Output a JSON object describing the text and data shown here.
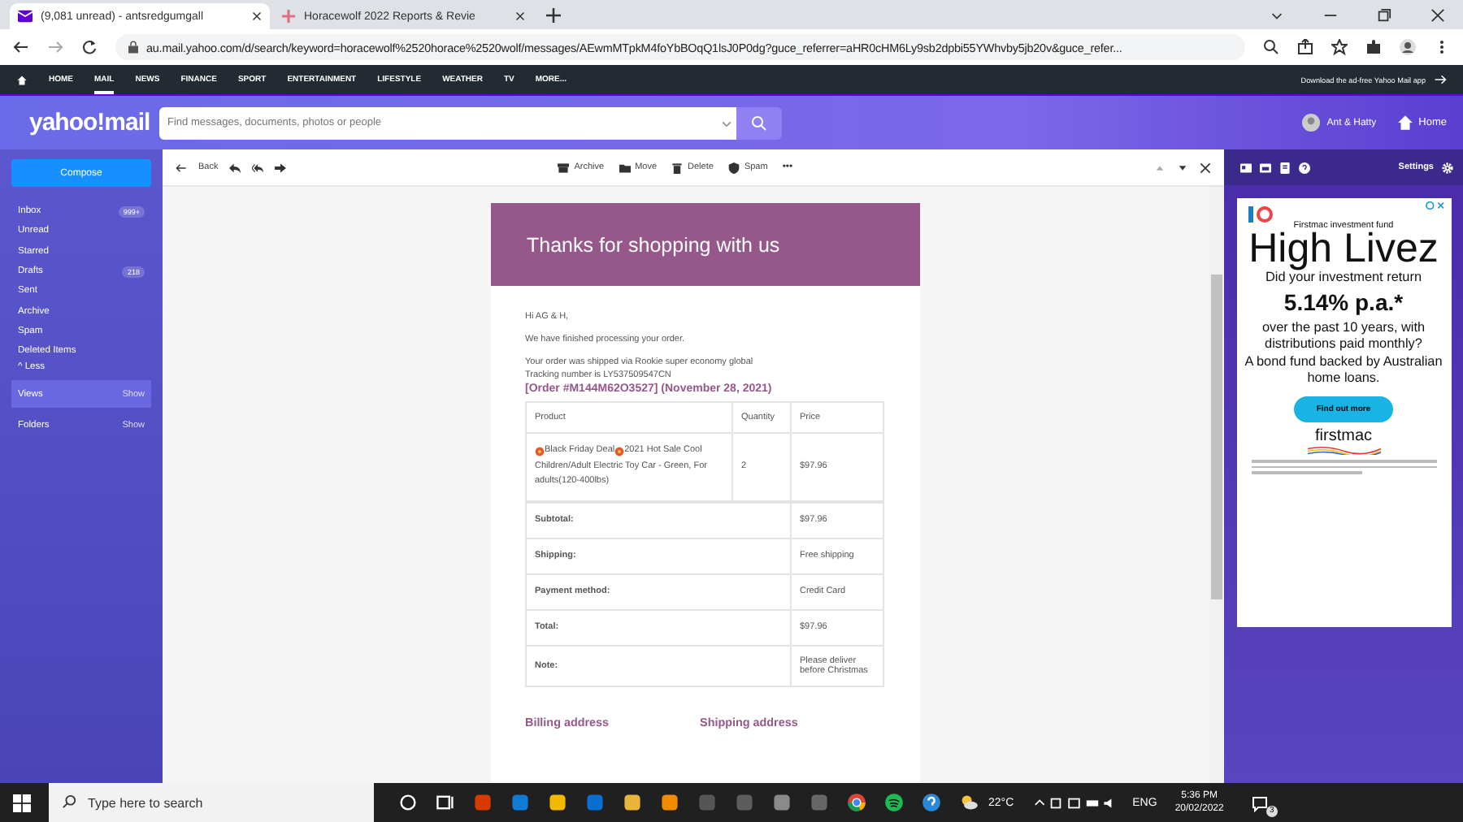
{
  "browser": {
    "tabs": [
      {
        "title": "(9,081 unread) - antsredgumgall",
        "selected": true,
        "kind": "mail"
      },
      {
        "title": "Horacewolf 2022 Reports & Revie",
        "selected": false,
        "kind": "pin"
      }
    ],
    "url": "au.mail.yahoo.com/d/search/keyword=horacewolf%2520horace%2520wolf/messages/AEwmMTpkM4foYbBOqQ1lsJ0P0dg?guce_referrer=aHR0cHM6Ly9sb2dpbi55YWhvby5jb20v&guce_refer..."
  },
  "site_nav": {
    "items": [
      {
        "label": "HOME",
        "selected": false
      },
      {
        "label": "MAIL",
        "selected": true
      },
      {
        "label": "NEWS",
        "selected": false
      },
      {
        "label": "FINANCE",
        "selected": false
      },
      {
        "label": "SPORT",
        "selected": false
      },
      {
        "label": "ENTERTAINMENT",
        "selected": false
      },
      {
        "label": "LIFESTYLE",
        "selected": false
      },
      {
        "label": "WEATHER",
        "selected": false
      },
      {
        "label": "TV",
        "selected": false
      },
      {
        "label": "MORE...",
        "selected": false
      }
    ],
    "promo": "Download the ad-free Yahoo Mail app"
  },
  "header": {
    "logo": "yahoo!mail",
    "search": {
      "placeholder": "Find messages, documents, photos or people"
    },
    "user": "Ant & Hatty",
    "home": "Home"
  },
  "sidebar": {
    "compose": "Compose",
    "folders": [
      {
        "label": "Inbox",
        "badge": "999+"
      },
      {
        "label": "Unread"
      },
      {
        "label": "Starred"
      },
      {
        "label": "Drafts",
        "badge": "218"
      },
      {
        "label": "Sent"
      },
      {
        "label": "Archive"
      },
      {
        "label": "Spam"
      },
      {
        "label": "Deleted Items"
      }
    ],
    "less": "^ Less",
    "sections": [
      {
        "label": "Views",
        "action": "Show",
        "selected": true
      },
      {
        "label": "Folders",
        "action": "Show",
        "selected": false
      }
    ]
  },
  "toolbar": {
    "back": "Back",
    "actions": [
      {
        "label": "Archive",
        "kind": "archive"
      },
      {
        "label": "Move",
        "kind": "move"
      },
      {
        "label": "Delete",
        "kind": "delete"
      },
      {
        "label": "Spam",
        "kind": "spam"
      }
    ],
    "more": "•••"
  },
  "email": {
    "banner": "Thanks for shopping with us",
    "greeting": "Hi AG & H,",
    "paragraphs": [
      "We have finished processing your order."
    ],
    "shipping_lines": [
      "Your order was shipped via Rookie super economy global",
      "Tracking number is LY537509547CN"
    ],
    "order_heading": "[Order #M144M62O3527] (November 28, 2021)",
    "columns": [
      "Product",
      "Quantity",
      "Price"
    ],
    "items": [
      {
        "product_parts": [
          "Black Friday Deal",
          "2021 Hot Sale Cool"
        ],
        "product_rest": "Children/Adult Electric Toy Car - Green, For adults(120-400lbs)",
        "quantity": "2",
        "price": "$97.96"
      }
    ],
    "totals": [
      {
        "label": "Subtotal:",
        "value": "$97.96"
      },
      {
        "label": "Shipping:",
        "value": "Free shipping"
      },
      {
        "label": "Payment method:",
        "value": "Credit Card"
      },
      {
        "label": "Total:",
        "value": "$97.96"
      },
      {
        "label": "Note:",
        "value": "Please deliver before Christmas"
      }
    ],
    "address_headings": [
      "Billing address",
      "Shipping address"
    ]
  },
  "right_panel": {
    "settings": "Settings"
  },
  "ad": {
    "brand_line": "Firstmac investment fund",
    "headline": "High Livez",
    "question": "Did your investment return",
    "rate": "5.14% p.a.*",
    "detail": "over the past 10 years, with distributions paid monthly?",
    "pitch": "A bond fund backed by Australian home loans.",
    "cta": "Find out more",
    "logo": "firstmac"
  },
  "taskbar": {
    "search": {
      "placeholder": "Type here to search"
    },
    "weather": "22°C",
    "language": "ENG",
    "time": "5:36 PM",
    "date": "20/02/2022",
    "notifications": "3"
  }
}
